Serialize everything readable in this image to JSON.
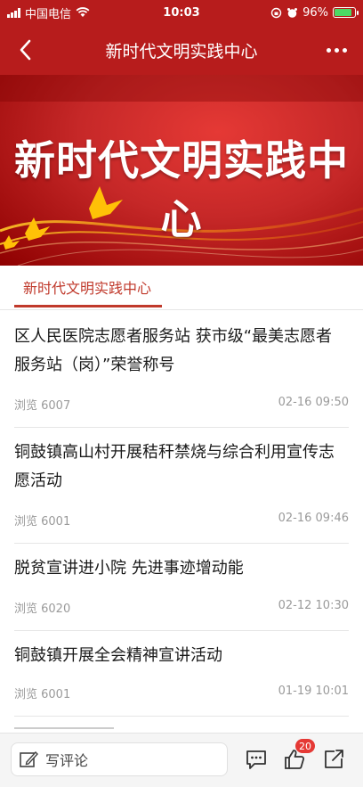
{
  "status_bar": {
    "carrier": "中国电信",
    "time": "10:03",
    "battery_percent": "96%",
    "battery_level": 0.96
  },
  "nav": {
    "title": "新时代文明实践中心"
  },
  "banner": {
    "title": "新时代文明实践中心"
  },
  "tab": {
    "label": "新时代文明实践中心"
  },
  "news": [
    {
      "title_line1": "区人民医院志愿者服务站 获市级“最美志愿者",
      "title_line2": "服务站（岗）”荣誉称号",
      "views": "浏览 6007",
      "date": "02-16 09:50"
    },
    {
      "title_line1": "铜鼓镇高山村开展秸秆禁烧与综合利用宣传志",
      "title_line2": "愿活动",
      "views": "浏览 6001",
      "date": "02-16 09:46"
    },
    {
      "title_line1": "脱贫宣讲进小院 先进事迹增动能",
      "views": "浏览 6020",
      "date": "02-12 10:30"
    },
    {
      "title_line1": "铜鼓镇开展全会精神宣讲活动",
      "views": "浏览 6001",
      "date": "01-19 10:01"
    }
  ],
  "bottom_bar": {
    "comment_placeholder": "写评论",
    "like_count": "20"
  },
  "colors": {
    "brand_red": "#b71c1c",
    "tab_red": "#c0392b",
    "badge_red": "#e53935",
    "battery_green": "#4cd964"
  },
  "icons": [
    "signal-icon",
    "wifi-icon",
    "lock-rotation-icon",
    "alarm-icon",
    "battery-icon",
    "back-icon",
    "more-icon",
    "edit-icon",
    "comment-icon",
    "like-icon",
    "share-icon"
  ]
}
